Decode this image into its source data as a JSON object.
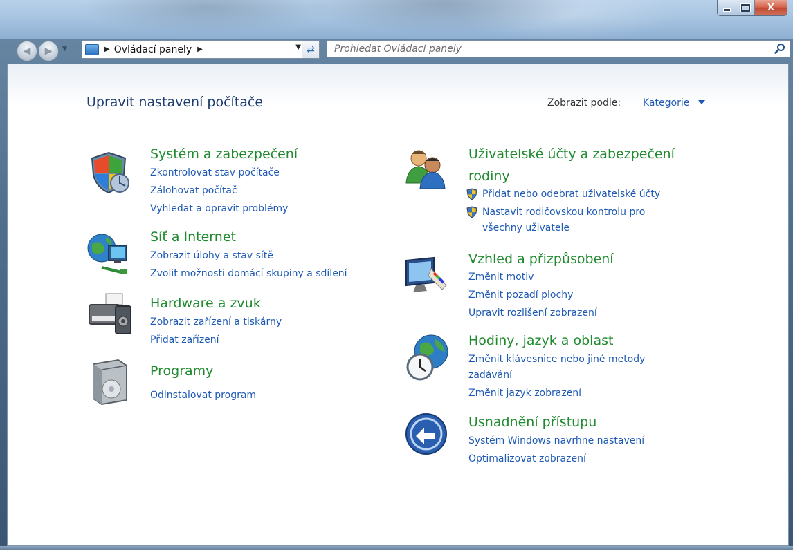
{
  "window": {
    "caption": {
      "minimize": "–",
      "maximize": "□",
      "close": "X"
    }
  },
  "navigation": {
    "address": {
      "breadcrumb": "Ovládací panely"
    },
    "search": {
      "placeholder": "Prohledat Ovládací panely"
    }
  },
  "header": {
    "title": "Upravit nastavení počítače",
    "view_by_label": "Zobrazit podle:",
    "view_by_value": "Kategorie"
  },
  "categories": {
    "system": {
      "title": "Systém a zabezpečení",
      "links": [
        "Zkontrolovat stav počítače",
        "Zálohovat počítač",
        "Vyhledat a opravit problémy"
      ]
    },
    "network": {
      "title": "Síť a Internet",
      "links": [
        "Zobrazit úlohy a stav sítě",
        "Zvolit možnosti domácí skupiny a sdílení"
      ]
    },
    "hardware": {
      "title": "Hardware a zvuk",
      "links": [
        "Zobrazit zařízení a tiskárny",
        "Přidat zařízení"
      ]
    },
    "programs": {
      "title": "Programy",
      "links": [
        "Odinstalovat program"
      ]
    },
    "users": {
      "title_line1": "Uživatelské účty a zabezpečení",
      "title_line2": "rodiny",
      "links": [
        "Přidat nebo odebrat uživatelské účty",
        "Nastavit rodičovskou kontrolu pro",
        "všechny uživatele"
      ]
    },
    "appearance": {
      "title": "Vzhled a přizpůsobení",
      "links": [
        "Změnit motiv",
        "Změnit pozadí plochy",
        "Upravit rozlišení zobrazení"
      ]
    },
    "clock": {
      "title": "Hodiny, jazyk a oblast",
      "links": [
        "Změnit klávesnice nebo jiné metody",
        "zadávání",
        "Změnit jazyk zobrazení"
      ]
    },
    "access": {
      "title": "Usnadnění přístupu",
      "links": [
        "Systém Windows navrhne nastavení",
        "Optimalizovat zobrazení"
      ]
    }
  }
}
